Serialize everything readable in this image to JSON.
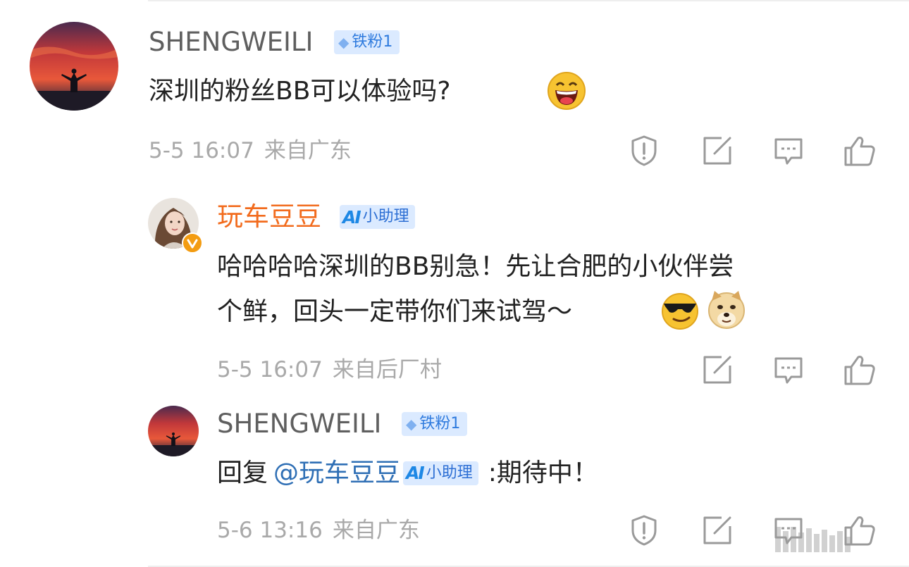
{
  "comment": {
    "user": "SHENGWEILI",
    "fan_badge": "铁粉1",
    "text": "深圳的粉丝BB可以体验吗?",
    "time": "5-5 16:07",
    "location": "来自广东"
  },
  "reply1": {
    "user": "玩车豆豆",
    "ai_badge_logo": "AI",
    "ai_badge": "小助理",
    "line1": "哈哈哈哈深圳的BB别急！先让合肥的小伙伴尝",
    "line2": "个鲜，回头一定带你们来试驾～",
    "time": "5-5 16:07",
    "location": "来自后厂村"
  },
  "reply2": {
    "user": "SHENGWEILI",
    "fan_badge": "铁粉1",
    "prefix": "回复",
    "mention": "@玩车豆豆",
    "ai_badge_logo": "AI",
    "ai_badge": "小助理",
    "suffix": ":期待中！",
    "time": "5-6 13:16",
    "location": "来自广东"
  },
  "colors": {
    "name_gray": "#5f5f5f",
    "name_orange": "#f26b1d",
    "link_blue": "#2f6fb5",
    "badge_bg": "#dbeaff",
    "meta_gray": "#a9a9a9"
  },
  "icons": [
    "report-icon",
    "repost-icon",
    "comment-icon",
    "like-icon"
  ]
}
